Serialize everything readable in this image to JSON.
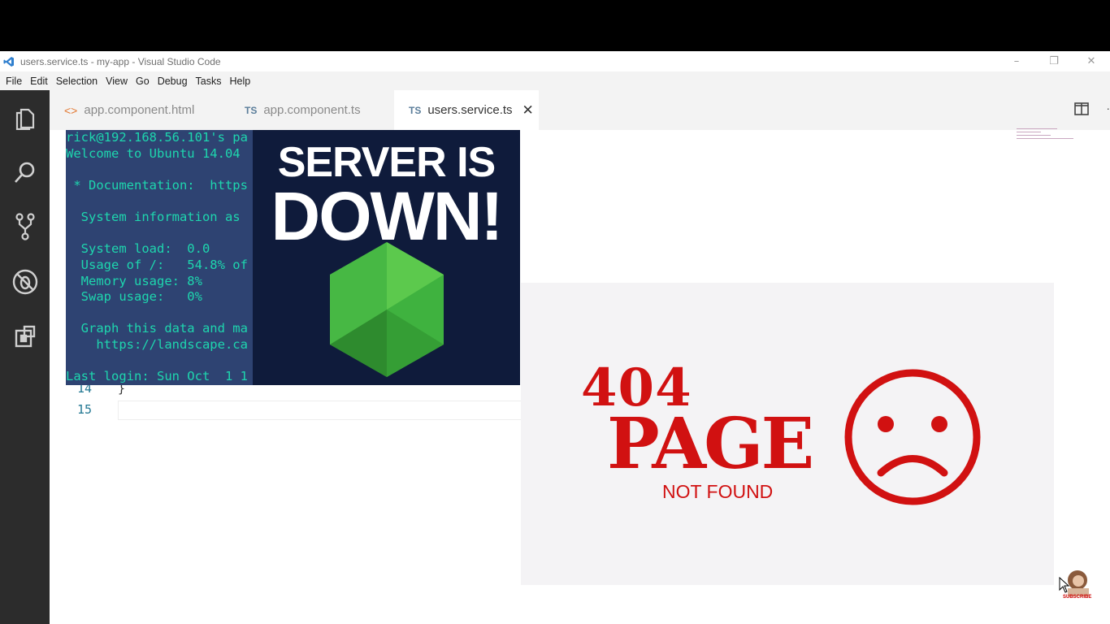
{
  "window": {
    "title": "users.service.ts - my-app - Visual Studio Code",
    "controls": [
      "–",
      "❐",
      "✕"
    ]
  },
  "menu": [
    {
      "label": "File"
    },
    {
      "label": "Edit"
    },
    {
      "label": "Selection"
    },
    {
      "label": "View"
    },
    {
      "label": "Go"
    },
    {
      "label": "Debug"
    },
    {
      "label": "Tasks"
    },
    {
      "label": "Help"
    }
  ],
  "activity_bar": {
    "icons": [
      "files-icon",
      "search-icon",
      "source-control-icon",
      "debug-icon",
      "extensions-icon"
    ]
  },
  "tabs": [
    {
      "label": "app.component.html",
      "icon": "<>",
      "active": false
    },
    {
      "label": "app.component.ts",
      "icon": "TS",
      "active": false
    },
    {
      "label": "users.service.ts",
      "icon": "TS",
      "active": true,
      "close": "✕"
    }
  ],
  "editor": {
    "lines": [
      {
        "number": "14",
        "text": "}"
      },
      {
        "number": "15",
        "text": ""
      }
    ]
  },
  "terminal": {
    "lines": [
      "rick@192.168.56.101's pa",
      "Welcome to Ubuntu 14.04",
      "",
      " * Documentation:  https",
      "",
      "  System information as",
      "",
      "  System load:  0.0",
      "  Usage of /:   54.8% of",
      "  Memory usage: 8%",
      "  Swap usage:   0%",
      "",
      "  Graph this data and ma",
      "    https://landscape.ca",
      "",
      "Last login: Sun Oct  1 1"
    ]
  },
  "server_down": {
    "line1": "SERVER IS",
    "line2": "DOWN!"
  },
  "not_found": {
    "code": "404",
    "page": "PAGE",
    "subtitle": "NOT FOUND"
  },
  "subscribe": {
    "label": "SUBSCRIBE"
  },
  "colors": {
    "activity_bar": "#2c2c2c",
    "terminal_bg": "#2e4372",
    "terminal_text": "#1ed6ae",
    "server_down_bg": "#0f1b3b",
    "node_green": "#3fb23f",
    "error_red": "#d11111"
  }
}
